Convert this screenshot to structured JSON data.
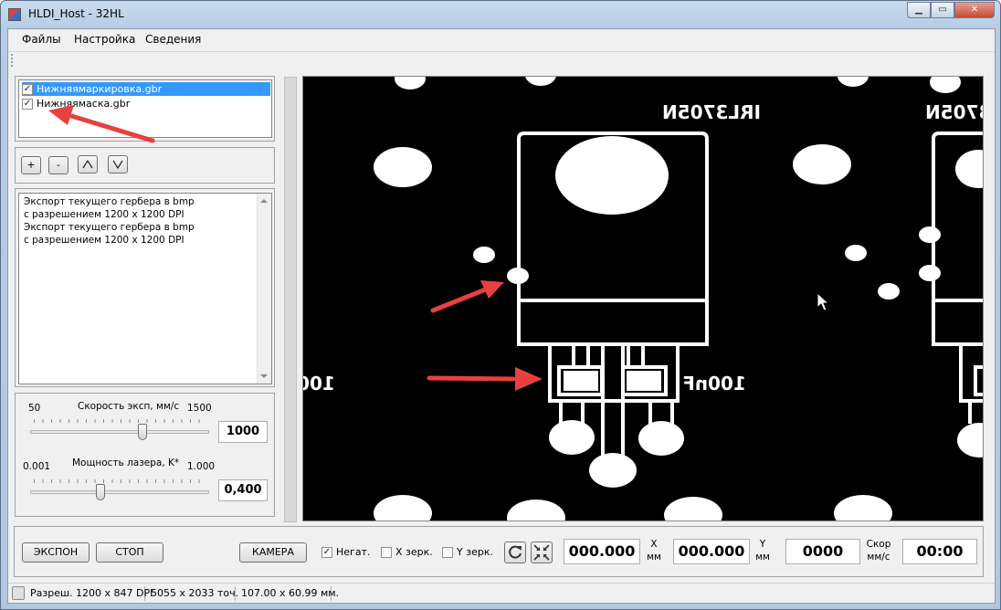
{
  "window": {
    "title": "HLDI_Host - 32HL"
  },
  "menu": {
    "items": [
      "Файлы",
      "Настройка",
      "Сведения"
    ]
  },
  "layers": {
    "items": [
      {
        "label": "Нижняямаркировка.gbr",
        "checked": true,
        "selected": true
      },
      {
        "label": "Нижняямаска.gbr",
        "checked": true,
        "selected": false
      }
    ]
  },
  "layer_buttons": {
    "add": "+",
    "remove": "-",
    "up": "/\\",
    "down": "\\/"
  },
  "log": {
    "lines": [
      "Экспорт текущего гербера в bmp",
      "с разрешением 1200 x 1200 DPI",
      "Экспорт текущего гербера в bmp",
      "с разрешением 1200 x 1200 DPI"
    ]
  },
  "speed": {
    "label": "Скорость эксп, мм/с",
    "min": "50",
    "max": "1500",
    "value": "1000"
  },
  "power": {
    "label": "Мощность лазера, K*",
    "min": "0.001",
    "max": "1.000",
    "value": "0,400"
  },
  "viewer": {
    "texts": {
      "part_label": "IRL3705N",
      "cap_label": "100nF",
      "cap_label_left": "100"
    }
  },
  "controls": {
    "expose": "ЭКСПОН",
    "stop": "СТОП",
    "camera": "КАМЕРА",
    "negative": {
      "label": "Негат.",
      "checked": true
    },
    "mirror_x": {
      "label": "X зерк.",
      "checked": false
    },
    "mirror_y": {
      "label": "Y зерк.",
      "checked": false
    },
    "x": {
      "value": "000.000",
      "label": "X",
      "unit": "мм"
    },
    "y": {
      "value": "000.000",
      "label": "Y",
      "unit": "мм"
    },
    "speed_readout": {
      "value": "0000",
      "label": "Скор",
      "unit": "мм/с"
    },
    "time": {
      "value": "00:00"
    }
  },
  "status": {
    "resolution": "Разреш. 1200 x 847 DPI",
    "points": "5055 x 2033 точ.",
    "size": "107.00 x 60.99 мм."
  },
  "colors": {
    "selection": "#3399ff",
    "annotation_arrow": "#e84040",
    "viewer_bg": "#000000"
  }
}
